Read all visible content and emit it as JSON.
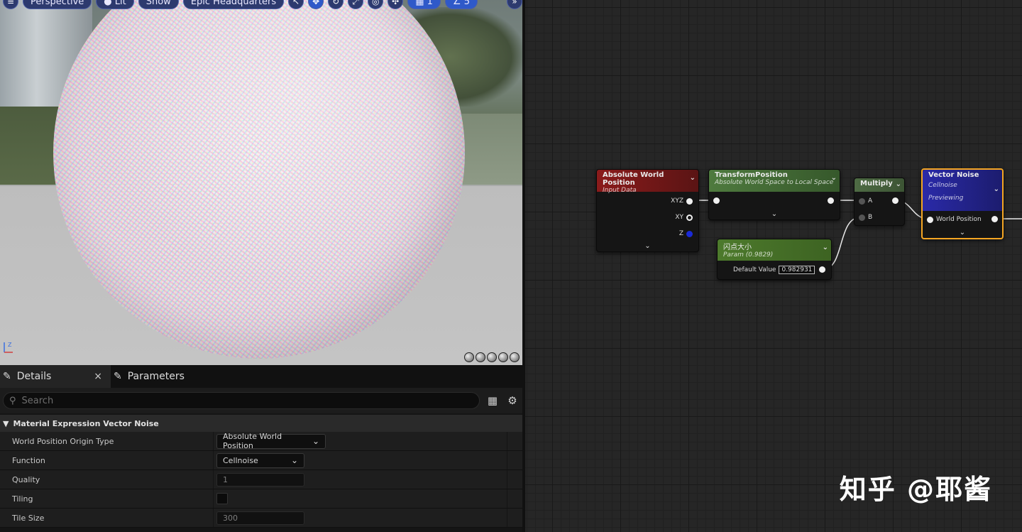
{
  "viewport": {
    "view_mode": "Perspective",
    "lit": "Lit",
    "show": "Show",
    "scene": "Epic Headquarters",
    "grid_count": "1",
    "angle_snap": "5"
  },
  "panel_tabs": [
    {
      "label": "Details"
    },
    {
      "label": "Parameters"
    }
  ],
  "search": {
    "placeholder": "Search",
    "value": ""
  },
  "details": {
    "section_title": "Material Expression Vector Noise",
    "rows": [
      {
        "label": "World Position Origin Type",
        "value": "Absolute World Position"
      },
      {
        "label": "Function",
        "value": "Cellnoise"
      },
      {
        "label": "Quality",
        "value": "1"
      },
      {
        "label": "Tiling",
        "value": ""
      },
      {
        "label": "Tile Size",
        "value": "300"
      }
    ]
  },
  "graph": {
    "node_absolute_world_position": {
      "title": "Absolute World Position",
      "subtitle": "Input Data",
      "pins": [
        "XYZ",
        "XY",
        "Z"
      ]
    },
    "node_transform_position": {
      "title": "TransformPosition",
      "subtitle": "Absolute World Space to Local Space"
    },
    "node_multiply": {
      "title": "Multiply",
      "pins": [
        "A",
        "B"
      ]
    },
    "node_vector_noise": {
      "title": "Vector Noise",
      "subtitle": "Cellnoise",
      "status": "Previewing",
      "pin": "World Position"
    },
    "node_param": {
      "title": "闪点大小",
      "subtitle": "Param (0.9829)",
      "default_label": "Default Value",
      "default_value": "0.982931"
    }
  },
  "watermark": "知乎 @耶酱",
  "colors": {
    "input_node_header": "#8b1b1b",
    "transform_node_header": "#4e7a3e",
    "param_node_header": "#4d7a2c",
    "vector_noise_header": "#2a2aa8",
    "selection_outline": "#f5a623",
    "toolbar_accent": "#2f59c9"
  }
}
